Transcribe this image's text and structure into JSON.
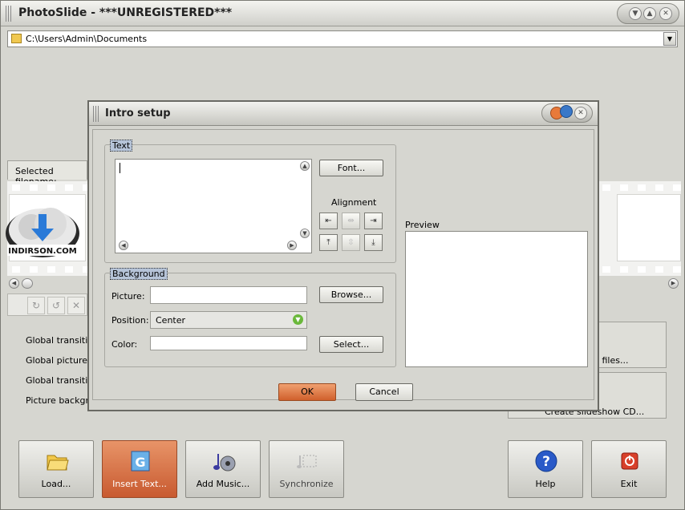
{
  "app": {
    "title": "PhotoSlide - ***UNREGISTERED***",
    "path": "C:\\Users\\Admin\\Documents",
    "selected_filename_label": "Selected filename:",
    "logo_text": "INDIRSON.COM",
    "global_labels": [
      "Global transition",
      "Global picture du",
      "Global transition",
      "Picture backgrou"
    ],
    "right_panel": [
      "w files...",
      "Create slideshow CD..."
    ]
  },
  "bottom_buttons": [
    {
      "label": "Load...",
      "icon": "folder-icon"
    },
    {
      "label": "Insert Text...",
      "icon": "insert-text-icon"
    },
    {
      "label": "Add Music...",
      "icon": "music-icon"
    },
    {
      "label": "Synchronize",
      "icon": "synchronize-icon"
    },
    {
      "label": "Help",
      "icon": "help-icon"
    },
    {
      "label": "Exit",
      "icon": "exit-icon"
    }
  ],
  "dialog": {
    "title": "Intro setup",
    "text_group": "Text",
    "font_button": "Font...",
    "alignment_label": "Alignment",
    "preview_label": "Preview",
    "background_group": "Background",
    "picture_label": "Picture:",
    "browse_button": "Browse...",
    "position_label": "Position:",
    "position_value": "Center",
    "color_label": "Color:",
    "select_button": "Select...",
    "ok_button": "OK",
    "cancel_button": "Cancel"
  },
  "colors": {
    "accent": "#d8703c",
    "legend_highlight": "#b6c4d8"
  }
}
